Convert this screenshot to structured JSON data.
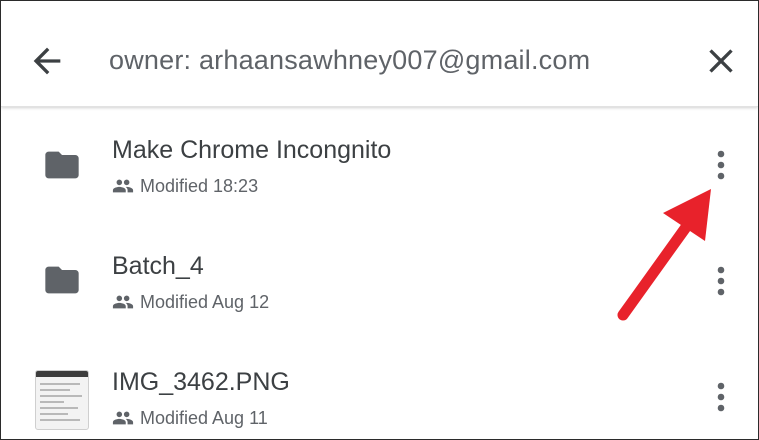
{
  "search": {
    "query": "owner: arhaansawhney007@gmail.com",
    "back_icon": "arrow-back-icon",
    "close_icon": "close-icon"
  },
  "files": [
    {
      "name": "Make Chrome Incongnito",
      "meta": "Modified 18:23",
      "type": "folder",
      "icon": "folder-icon"
    },
    {
      "name": "Batch_4",
      "meta": "Modified Aug 12",
      "type": "folder",
      "icon": "folder-icon"
    },
    {
      "name": "IMG_3462.PNG",
      "meta": "Modified Aug 11",
      "type": "image",
      "icon": "image-thumbnail"
    }
  ],
  "colors": {
    "icon": "#5f6368",
    "title_text": "#3c4043",
    "annotation_arrow": "#e8222b"
  }
}
